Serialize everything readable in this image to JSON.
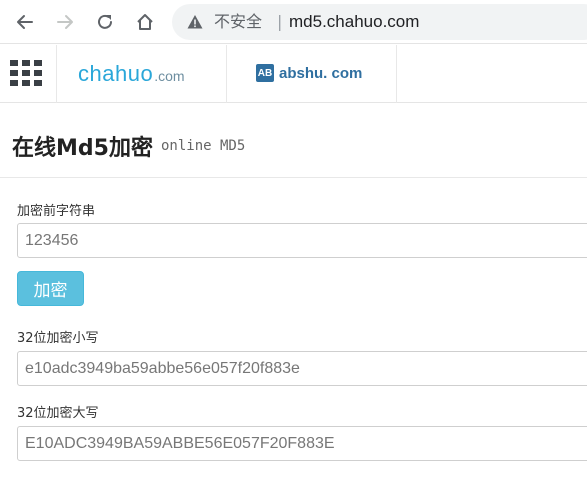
{
  "browser": {
    "security_label": "不安全",
    "separator": "|",
    "url": "md5.chahuo.com"
  },
  "header": {
    "logo_chahuo_main": "chahuo",
    "logo_chahuo_tld": ".com",
    "logo_abshu_badge": "AB",
    "logo_abshu_text": "abshu. com"
  },
  "page": {
    "title": "在线Md5加密",
    "subtitle": "online MD5"
  },
  "form": {
    "input_label": "加密前字符串",
    "input_value": "123456",
    "encrypt_button": "加密",
    "lower_label": "32位加密小写",
    "lower_value": "e10adc3949ba59abbe56e057f20f883e",
    "upper_label": "32位加密大写",
    "upper_value": "E10ADC3949BA59ABBE56E057F20F883E"
  }
}
